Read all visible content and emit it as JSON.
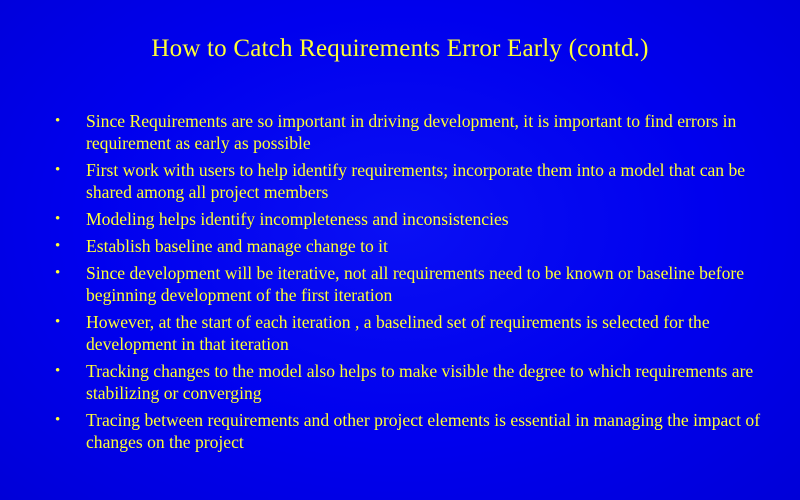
{
  "slide": {
    "title": "How to Catch Requirements Error Early (contd.)",
    "bullet_glyph": "•",
    "bullets": [
      "Since Requirements are so important in driving development, it is important to find errors in requirement as early as possible",
      "First work with users to help identify requirements; incorporate them into a model that can be shared among all project members",
      "Modeling helps identify incompleteness and inconsistencies",
      "Establish baseline and manage change to it",
      "Since development will be iterative, not all requirements need to be known or baseline before beginning development of the first iteration",
      "However, at the start of each iteration , a baselined set of requirements is selected for the development in that iteration",
      "Tracking changes to the model also helps to make visible the degree to which requirements are stabilizing or converging",
      "Tracing between requirements and other project elements is essential in managing the impact of changes on the project"
    ]
  },
  "colors": {
    "background": "#0000ee",
    "text": "#ffff33"
  }
}
